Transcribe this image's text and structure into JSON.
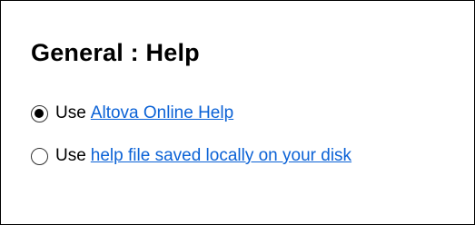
{
  "panel": {
    "title": "General : Help"
  },
  "options": [
    {
      "prefix": "Use",
      "link_text": "Altova Online Help",
      "selected": true
    },
    {
      "prefix": "Use",
      "link_text": "help file saved locally on your disk",
      "selected": false
    }
  ],
  "colors": {
    "link": "#0b62d6",
    "text": "#000000",
    "border": "#000000"
  }
}
